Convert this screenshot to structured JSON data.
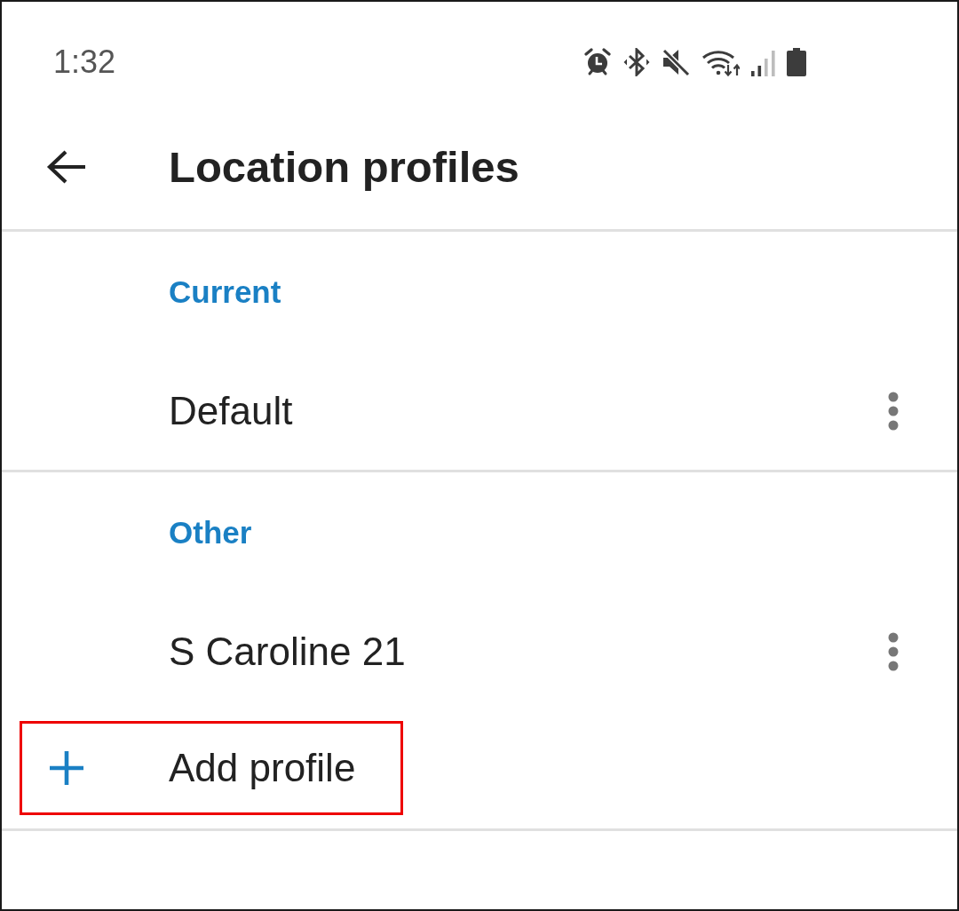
{
  "status_bar": {
    "time": "1:32"
  },
  "header": {
    "title": "Location profiles"
  },
  "sections": [
    {
      "title": "Current",
      "profiles": [
        {
          "name": "Default"
        }
      ]
    },
    {
      "title": "Other",
      "profiles": [
        {
          "name": "S Caroline 21"
        }
      ]
    }
  ],
  "add_button": {
    "label": "Add profile",
    "highlighted": true
  }
}
